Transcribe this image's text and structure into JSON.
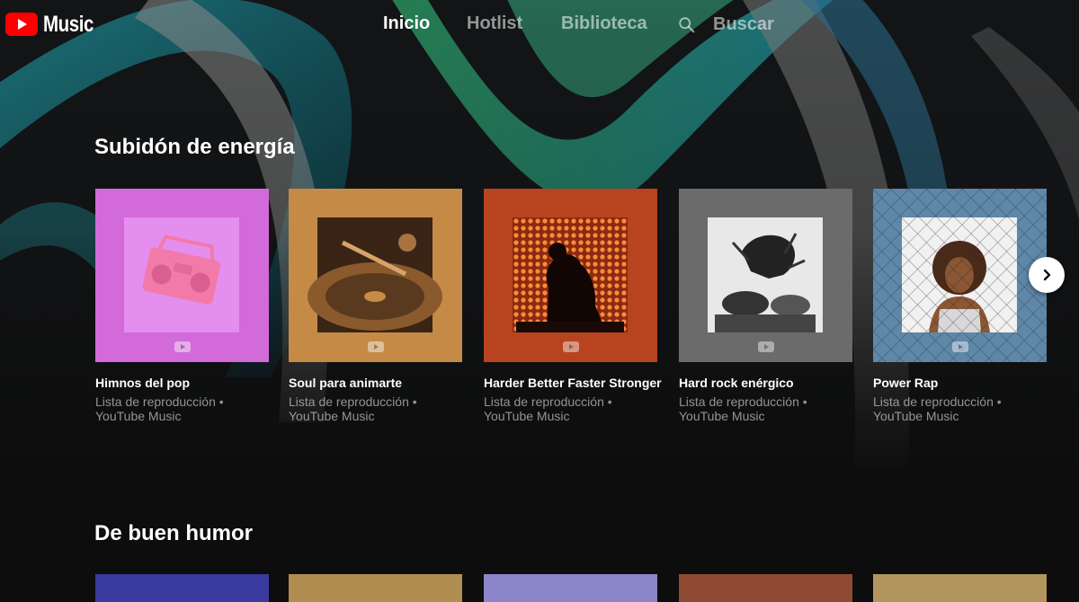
{
  "app": {
    "logo_text": "Music"
  },
  "nav": {
    "items": [
      {
        "label": "Inicio",
        "active": true
      },
      {
        "label": "Hotlist",
        "active": false
      },
      {
        "label": "Biblioteca",
        "active": false
      }
    ],
    "search_label": "Buscar"
  },
  "sections": [
    {
      "title": "Subidón de energía",
      "cards": [
        {
          "title": "Himnos del pop",
          "subtitle_line1": "Lista de reproducción •",
          "subtitle_line2": "YouTube Music",
          "color": "#d26ad9"
        },
        {
          "title": "Soul para animarte",
          "subtitle_line1": "Lista de reproducción •",
          "subtitle_line2": "YouTube Music",
          "color": "#c58a46"
        },
        {
          "title": "Harder Better Faster Stronger",
          "subtitle_line1": "Lista de reproducción •",
          "subtitle_line2": "YouTube Music",
          "color": "#b8431f"
        },
        {
          "title": "Hard rock enérgico",
          "subtitle_line1": "Lista de reproducción •",
          "subtitle_line2": "YouTube Music",
          "color": "#6b6b6b"
        },
        {
          "title": "Power Rap",
          "subtitle_line1": "Lista de reproducción •",
          "subtitle_line2": "YouTube Music",
          "color": "#5f87a8"
        }
      ],
      "next_button_icon": "chevron-right-icon"
    },
    {
      "title": "De buen humor",
      "cards": [
        {
          "color": "#3b3a9e"
        },
        {
          "color": "#b08d50"
        },
        {
          "color": "#8a86c9"
        },
        {
          "color": "#8f4a33"
        },
        {
          "color": "#b1955c"
        }
      ]
    }
  ]
}
